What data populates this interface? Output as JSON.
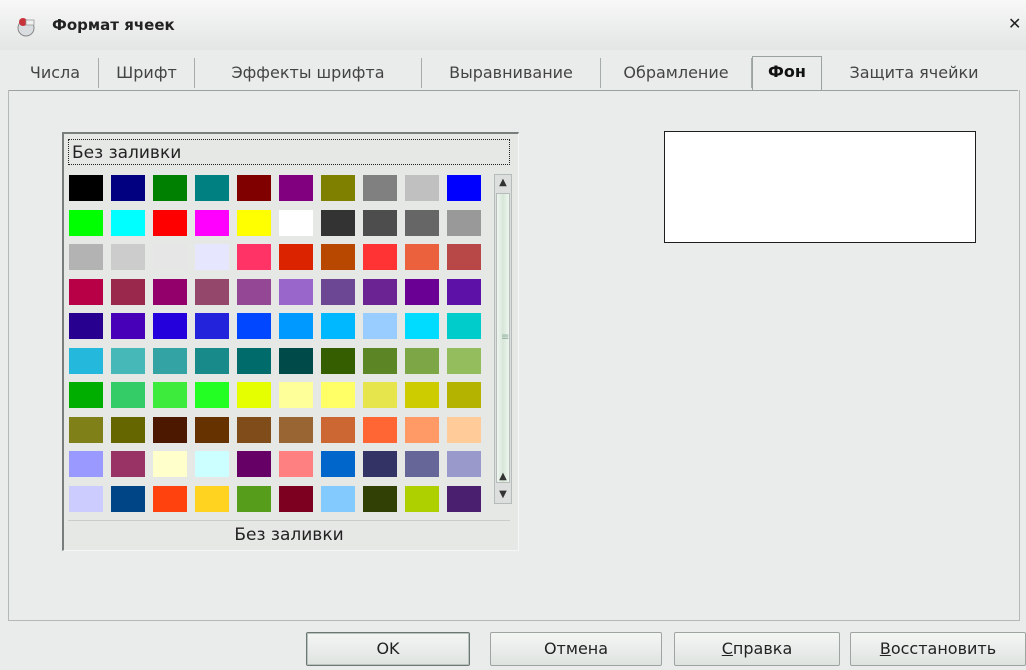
{
  "window": {
    "title": "Формат ячеек",
    "close_glyph": "✕"
  },
  "tabs": [
    {
      "label": "Числа"
    },
    {
      "label": "Шрифт"
    },
    {
      "label": "Эффекты шрифта"
    },
    {
      "label": "Выравнивание"
    },
    {
      "label": "Обрамление"
    },
    {
      "label": "Фон",
      "active": true
    },
    {
      "label": "Защита ячейки"
    }
  ],
  "background": {
    "no_fill_label": "Без заливки",
    "selected_name": "Без заливки",
    "preview_color": "#ffffff",
    "palette": [
      [
        "#000000",
        "#000080",
        "#008000",
        "#008080",
        "#800000",
        "#800080",
        "#808000",
        "#808080",
        "#c0c0c0",
        "#0000ff"
      ],
      [
        "#00ff00",
        "#00ffff",
        "#ff0000",
        "#ff00ff",
        "#ffff00",
        "#ffffff",
        "#333333",
        "#4d4d4d",
        "#666666",
        "#999999"
      ],
      [
        "#b3b3b3",
        "#cccccc",
        "#e6e6e6",
        "#e6e6ff",
        "#ff3366",
        "#dc2300",
        "#b84700",
        "#ff3333",
        "#eb613d",
        "#b84747"
      ],
      [
        "#b80047",
        "#99284c",
        "#94006b",
        "#94476b",
        "#944794",
        "#9966cc",
        "#6b4794",
        "#6b2394",
        "#6b0094",
        "#5e11a6"
      ],
      [
        "#28008f",
        "#4700b8",
        "#2300dc",
        "#2323dc",
        "#0047ff",
        "#0099ff",
        "#00b8ff",
        "#99ccff",
        "#00dcff",
        "#00cccc"
      ],
      [
        "#23b8dc",
        "#47b8b8",
        "#33a3a3",
        "#198a8a",
        "#006b6b",
        "#004a4a",
        "#355e00",
        "#5c8526",
        "#7da647",
        "#94bd5e"
      ],
      [
        "#00ae00",
        "#33cc66",
        "#3deb3d",
        "#23ff23",
        "#e6ff00",
        "#ffff99",
        "#ffff66",
        "#e6e64c",
        "#cccc00",
        "#b3b300"
      ],
      [
        "#808019",
        "#666600",
        "#4c1900",
        "#663300",
        "#804c19",
        "#996633",
        "#cc6633",
        "#ff6633",
        "#ff9966",
        "#ffcc99"
      ],
      [
        "#9999ff",
        "#993366",
        "#ffffcc",
        "#ccffff",
        "#660066",
        "#ff8080",
        "#0066cc",
        "#333366",
        "#666699",
        "#9999cc"
      ],
      [
        "#ccccff",
        "#004586",
        "#ff420e",
        "#ffd320",
        "#579d1c",
        "#7e0021",
        "#83caff",
        "#314004",
        "#aecf00",
        "#4b1f6f"
      ]
    ]
  },
  "buttons": {
    "ok": "OK",
    "cancel": "Отмена",
    "help_mnemonic": "С",
    "help_rest": "правка",
    "reset_mnemonic": "В",
    "reset_rest": "осстановить"
  }
}
